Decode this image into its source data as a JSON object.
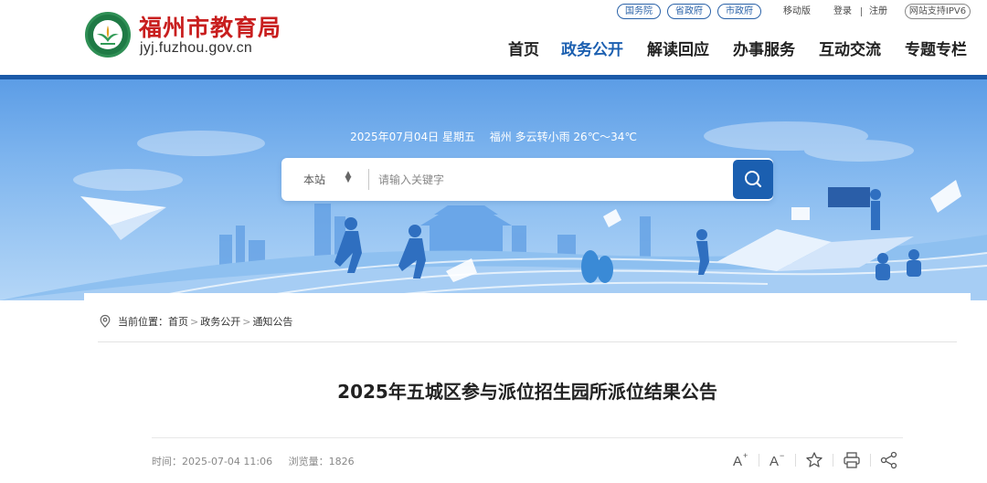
{
  "header": {
    "title": "福州市教育局",
    "domain": "jyj.fuzhou.gov.cn",
    "top_links": {
      "state_council": "国务院",
      "province_gov": "省政府",
      "city_gov": "市政府",
      "mobile": "移动版",
      "login": "登录",
      "register": "注册",
      "ipv6": "网站支持IPV6"
    },
    "nav": [
      {
        "label": "首页"
      },
      {
        "label": "政务公开"
      },
      {
        "label": "解读回应"
      },
      {
        "label": "办事服务"
      },
      {
        "label": "互动交流"
      },
      {
        "label": "专题专栏"
      }
    ],
    "active_nav": "政务公开"
  },
  "banner": {
    "date": "2025年07月04日 星期五",
    "weather": "福州 多云转小雨 26℃～34℃",
    "search": {
      "scope": "本站",
      "placeholder": "请输入关键字"
    }
  },
  "breadcrumb": {
    "prefix": "当前位置：",
    "items": [
      "首页",
      "政务公开",
      "通知公告"
    ],
    "separator": ">"
  },
  "article": {
    "title": "2025年五城区参与派位招生园所派位结果公告",
    "time": "时间：2025-07-04 11:06",
    "views": "浏览量：1826"
  },
  "tools": {
    "font_larger": "A⁺",
    "font_smaller": "A⁻"
  },
  "colors": {
    "brand_blue": "#1b5fb0",
    "title_red": "#c81e1e",
    "emblem_green": "#1f7a45"
  }
}
